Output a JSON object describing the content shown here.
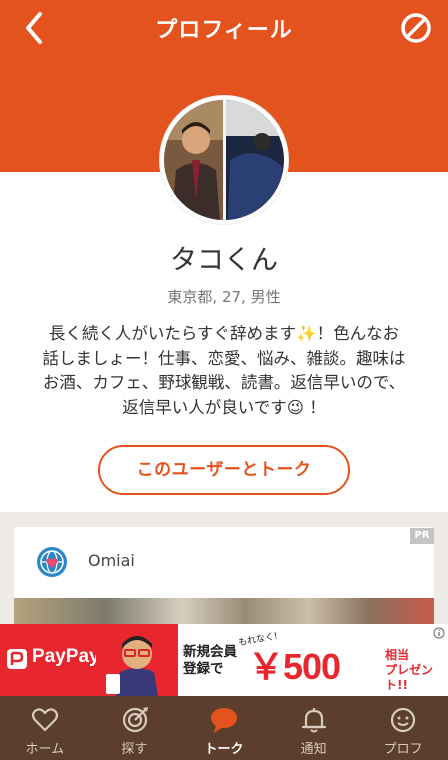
{
  "nav": {
    "title": "プロフィール",
    "back_icon": "chevron-left-icon",
    "block_icon": "block-icon"
  },
  "profile": {
    "name": "タコくん",
    "meta": "東京都, 27, 男性",
    "bio_lines": [
      "長く続く人がいたらすぐ辞めます✨！色んなお",
      "話しましょー！仕事、恋愛、悩み、雑談。趣味は",
      "お酒、カフェ、野球観戦、読書。返信早いので、",
      "返信早い人が良いです😉 ！"
    ]
  },
  "talk_button": {
    "label": "このユーザーとトーク"
  },
  "ad": {
    "badge": "PR",
    "advertiser": "Omiai"
  },
  "banner": {
    "brand": "PayPay",
    "line1": "新規会員",
    "line2": "登録で",
    "motto": "もれなく!",
    "amount": "￥500",
    "suffix1": "相当",
    "suffix2": "プレゼント!!"
  },
  "tabs": [
    {
      "label": "ホーム",
      "icon": "heart-icon"
    },
    {
      "label": "探す",
      "icon": "target-icon"
    },
    {
      "label": "トーク",
      "icon": "chat-bubble-icon",
      "active": true
    },
    {
      "label": "通知",
      "icon": "bell-icon"
    },
    {
      "label": "プロフ",
      "icon": "smiley-icon"
    }
  ],
  "colors": {
    "accent": "#e4531e",
    "tabbar": "#5b3f2c",
    "paypay_red": "#e8262d"
  }
}
